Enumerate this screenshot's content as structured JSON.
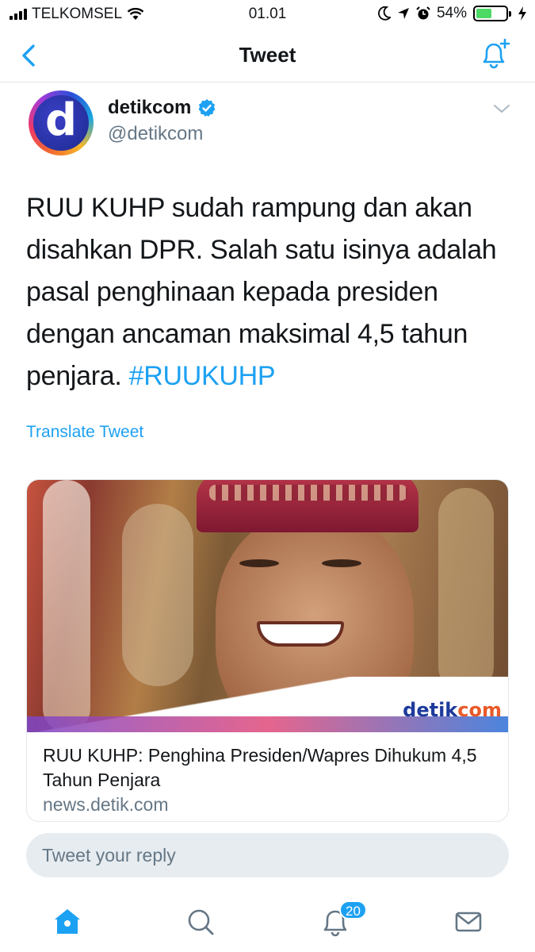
{
  "status_bar": {
    "carrier": "TELKOMSEL",
    "time": "01.01",
    "battery": "54%",
    "battery_level": 0.54,
    "icons": [
      "signal-icon",
      "wifi-icon",
      "moon-icon",
      "location-icon",
      "alarm-icon",
      "battery-icon",
      "charging-icon"
    ]
  },
  "nav": {
    "title": "Tweet",
    "back_icon": "chevron-left-icon",
    "notify_icon": "bell-plus-icon"
  },
  "tweet": {
    "display_name": "detikcom",
    "handle": "@detikcom",
    "avatar_letter": "d",
    "verified": true,
    "text": "RUU KUHP sudah rampung dan akan disahkan DPR. Salah satu isinya adalah pasal penghinaan kepada presiden dengan ancaman maksimal 4,5 tahun penjara.",
    "hashtag": "#RUUKUHP",
    "translate_label": "Translate Tweet"
  },
  "card": {
    "watermark_prefix": "detik",
    "watermark_suffix": "com",
    "title": "RUU KUHP: Penghina Presiden/Wapres Dihukum 4,5 Tahun Penjara",
    "domain": "news.detik.com"
  },
  "reply": {
    "placeholder": "Tweet your reply"
  },
  "tab_bar": {
    "items": [
      "home-icon",
      "search-icon",
      "notifications-icon",
      "messages-icon"
    ],
    "notification_count": "20",
    "accent_color": "#1da1f2"
  }
}
